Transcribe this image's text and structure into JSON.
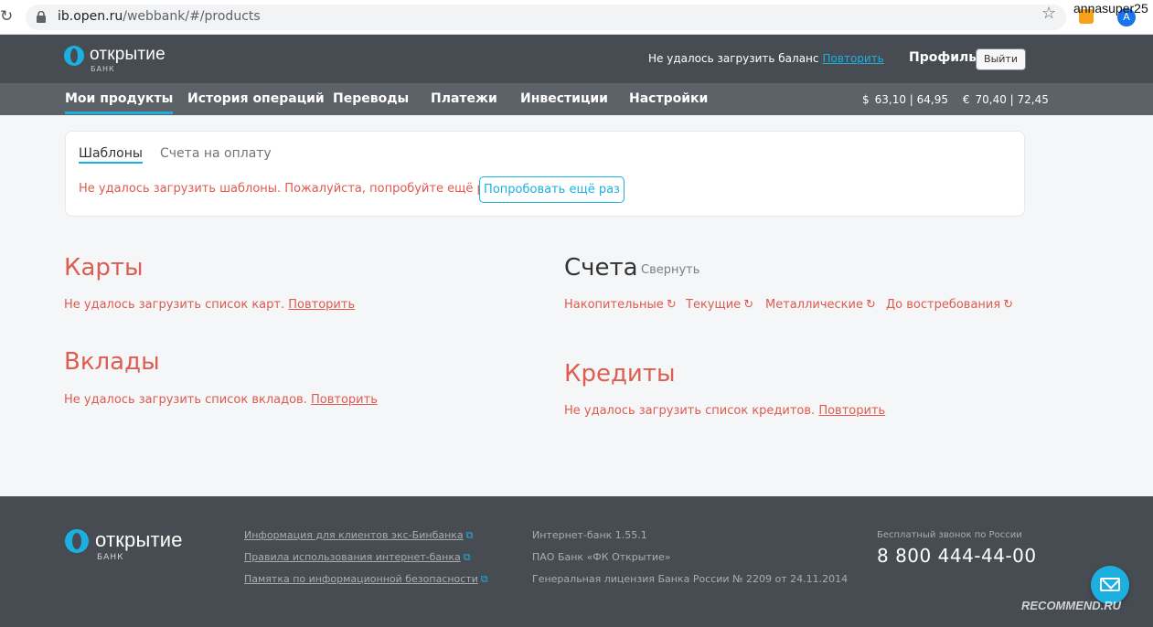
{
  "browser": {
    "url_host": "ib.open.ru",
    "url_path": "/webbank/#/products",
    "user_label": "annasuper25",
    "avatar_letter": "A"
  },
  "header": {
    "logo_name": "открытие",
    "logo_sub": "БАНК",
    "balance_error": "Не удалось загрузить баланс",
    "balance_retry": "Повторить",
    "profile": "Профиль",
    "logout": "Выйти"
  },
  "nav": {
    "items": [
      "Мои продукты",
      "История операций",
      "Переводы",
      "Платежи",
      "Инвестиции",
      "Настройки"
    ],
    "rates": [
      {
        "symbol": "$",
        "value": "63,10 | 64,95"
      },
      {
        "symbol": "€",
        "value": "70,40 | 72,45"
      }
    ]
  },
  "templates": {
    "tabs": [
      "Шаблоны",
      "Счета на оплату"
    ],
    "error": "Не удалось загрузить шаблоны. Пожалуйста, попробуйте ещё раз.",
    "retry_button": "Попробовать ещё раз"
  },
  "cards": {
    "title": "Карты",
    "error": "Не удалось загрузить список карт.",
    "retry": "Повторить"
  },
  "deposits": {
    "title": "Вклады",
    "error": "Не удалось загрузить список вкладов.",
    "retry": "Повторить"
  },
  "accounts": {
    "title": "Счета",
    "collapse": "Свернуть",
    "items": [
      "Накопительные",
      "Текущие",
      "Металлические",
      "До востребования"
    ]
  },
  "credits": {
    "title": "Кредиты",
    "error": "Не удалось загрузить список кредитов.",
    "retry": "Повторить"
  },
  "footer": {
    "logo_name": "открытие",
    "logo_sub": "БАНК",
    "links": [
      "Информация для клиентов экс-Бинбанка",
      "Правила использования интернет-банка",
      "Памятка по информационной безопасности"
    ],
    "info": [
      "Интернет-банк 1.55.1",
      "ПАО Банк «ФК Открытие»",
      "Генеральная лицензия Банка России № 2209 от 24.11.2014"
    ],
    "free_call": "Бесплатный звонок по России",
    "phone": "8 800 444-44-00"
  },
  "watermark": "RECOMMEND.RU",
  "colors": {
    "accent": "#1bb0e0",
    "error": "#e05a4e",
    "header_bg": "#464c52",
    "nav_bg": "#5c6268"
  }
}
